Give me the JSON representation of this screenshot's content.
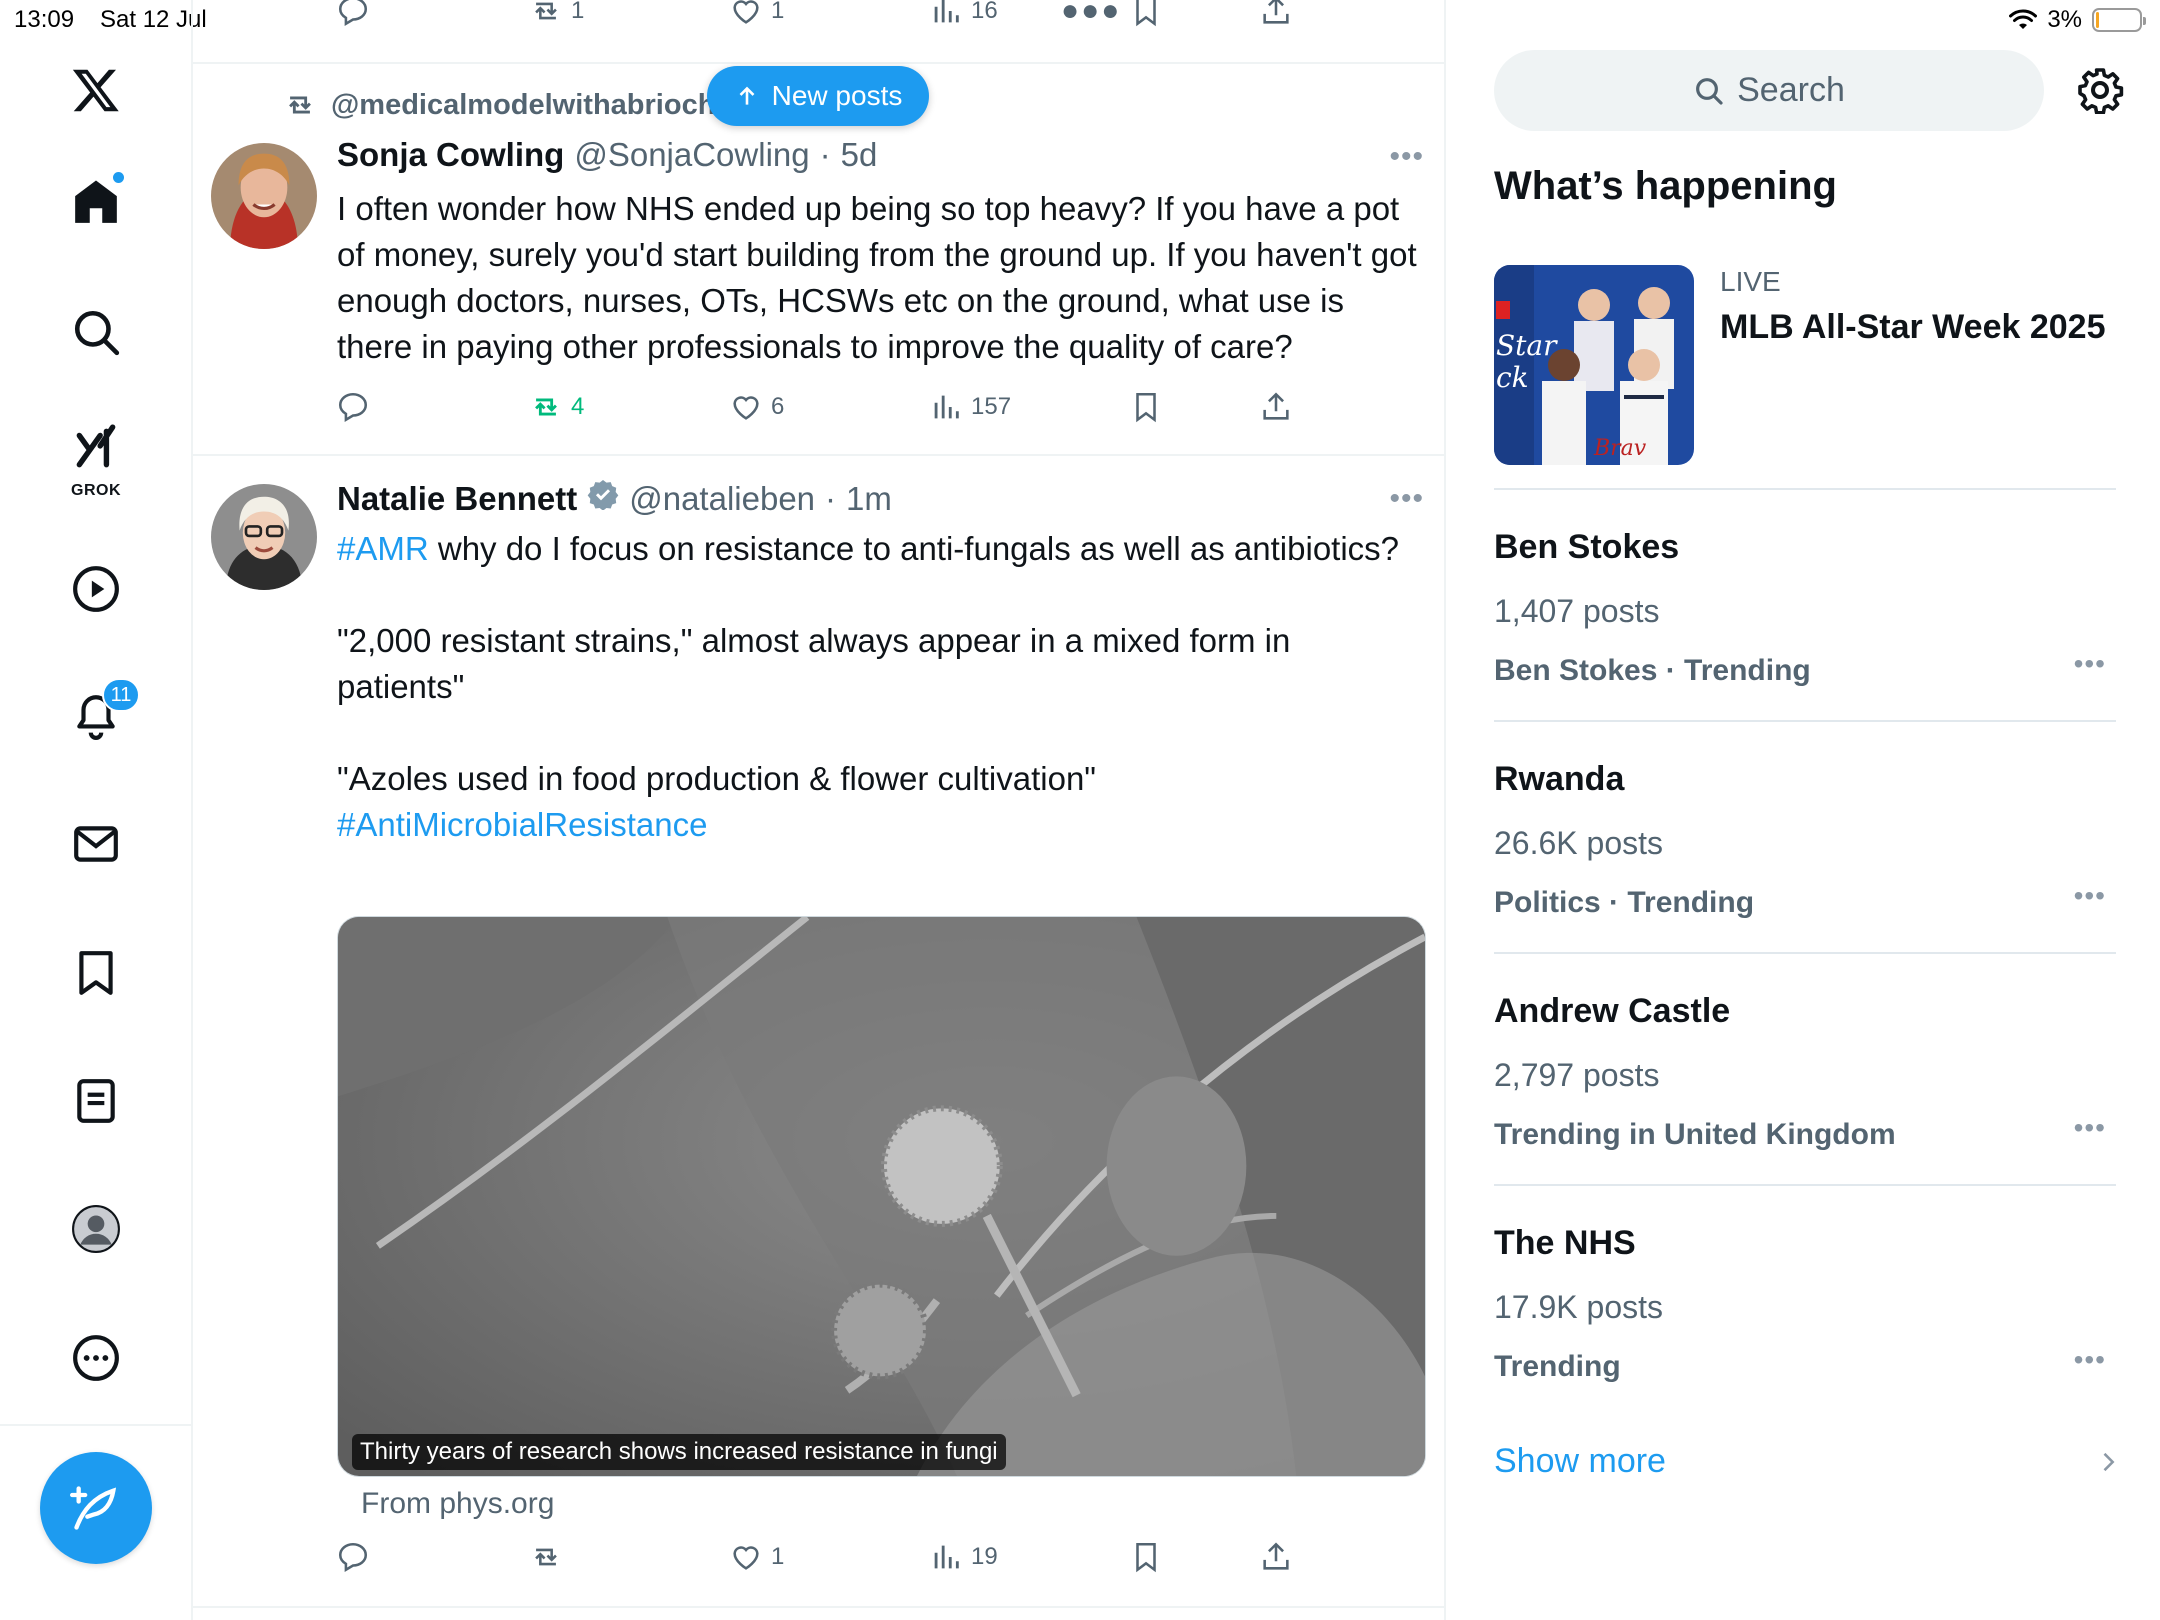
{
  "status": {
    "time": "13:09",
    "date": "Sat 12 Jul",
    "battery": "3%"
  },
  "nav": {
    "grok_label": "GROK",
    "notifications_badge": "11",
    "items": [
      "x-logo-icon",
      "home-icon",
      "search-icon",
      "grok-icon",
      "video-icon",
      "bell-icon",
      "mail-icon",
      "bookmark-icon",
      "lists-icon",
      "profile-icon",
      "more-circle-icon"
    ]
  },
  "top_actions": {
    "replies": "",
    "reposts": "1",
    "likes": "1",
    "views": "16"
  },
  "new_posts_label": "New posts",
  "tweet1": {
    "repost_by": "@medicalmodelwithabrioche reposted",
    "name": "Sonja Cowling",
    "handle": "@SonjaCowling",
    "dot": "·",
    "time": "5d",
    "text": "I often wonder how NHS ended up being so top heavy? If you have a pot of money, surely you'd start building from the ground up. If you haven't got enough doctors, nurses, OTs, HCSWs etc on the ground, what use is there in paying other professionals to improve the quality of care?",
    "actions": {
      "replies": "",
      "reposts": "4",
      "likes": "6",
      "views": "157"
    }
  },
  "tweet2": {
    "name": "Natalie Bennett",
    "handle": "@natalieben",
    "dot": "·",
    "time": "1m",
    "hashtag1": "#AMR",
    "line1": " why do I focus on resistance to anti-fungals as well as antibiotics?",
    "quote1": "\"2,000 resistant strains,\" almost always appear in a mixed form in patients\"",
    "quote2": "\"Azoles used in food production & flower cultivation\"",
    "hashtag2": "#AntiMicrobialResistance",
    "media_caption": "Thirty years of research shows increased resistance in fungi",
    "from": "From phys.org",
    "actions": {
      "replies": "",
      "reposts": "",
      "likes": "1",
      "views": "19"
    }
  },
  "right": {
    "search_placeholder": "Search",
    "whats_happening": "What’s happening",
    "live": {
      "label": "LIVE",
      "title": "MLB All-Star Week 2025"
    },
    "trends": [
      {
        "title": "Ben Stokes",
        "posts": "1,407 posts",
        "meta": "Ben Stokes · Trending"
      },
      {
        "title": "Rwanda",
        "posts": "26.6K posts",
        "meta": "Politics · Trending"
      },
      {
        "title": "Andrew Castle",
        "posts": "2,797 posts",
        "meta": "Trending in United Kingdom"
      },
      {
        "title": "The NHS",
        "posts": "17.9K posts",
        "meta": "Trending"
      }
    ],
    "show_more": "Show more"
  },
  "colors": {
    "accent": "#1d9bf0",
    "repost_green": "#00ba7c",
    "muted": "#536471"
  }
}
